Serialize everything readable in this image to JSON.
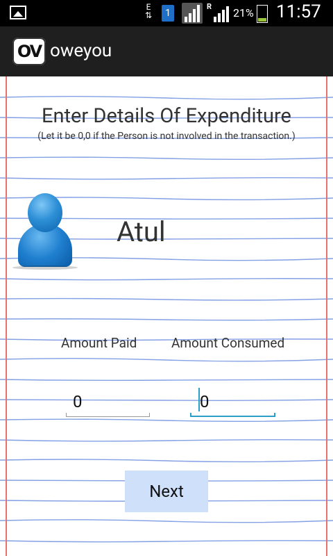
{
  "status_bar": {
    "network_type": "E",
    "sim_slot": "1",
    "roaming_indicator": "R",
    "battery_percent": "21%",
    "battery_level": 0.21,
    "time": "11:57"
  },
  "action_bar": {
    "logo_text": "OV",
    "title": "oweyou"
  },
  "form": {
    "heading": "Enter Details Of Expenditure",
    "subheading": "(Let it be 0,0 if the Person is not involved in the transaction.)",
    "person_name": "Atul",
    "amount_paid_label": "Amount Paid",
    "amount_consumed_label": "Amount Consumed",
    "amount_paid_value": "0",
    "amount_consumed_value": "0",
    "next_label": "Next"
  },
  "colors": {
    "ruled_line": "#6d8fe0",
    "margin_line": "#e57373",
    "focus_accent": "#2a9fc6",
    "button_bg": "#cfe0fb"
  }
}
